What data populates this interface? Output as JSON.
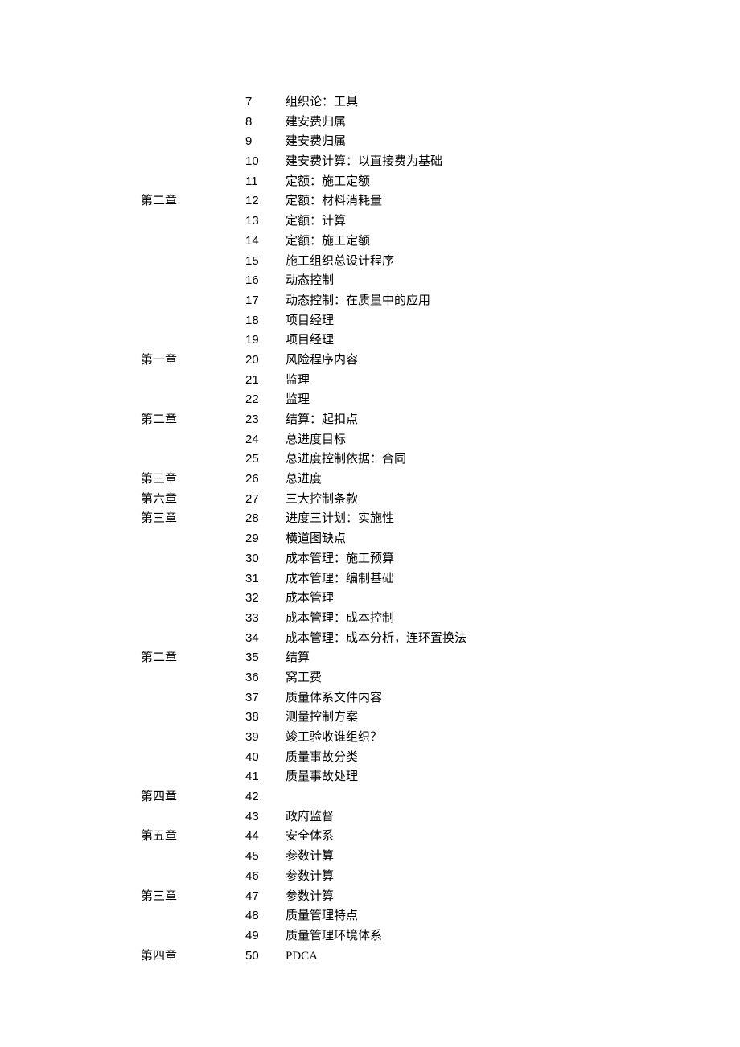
{
  "rows": [
    {
      "chapter": "",
      "num": "7",
      "topic": "组织论：工具"
    },
    {
      "chapter": "",
      "num": "8",
      "topic": "建安费归属"
    },
    {
      "chapter": "",
      "num": "9",
      "topic": "建安费归属"
    },
    {
      "chapter": "",
      "num": "10",
      "topic": "建安费计算：以直接费为基础"
    },
    {
      "chapter": "",
      "num": "11",
      "topic": "定额：施工定额"
    },
    {
      "chapter": "第二章",
      "num": "12",
      "topic": "定额：材料消耗量"
    },
    {
      "chapter": "",
      "num": "13",
      "topic": "定额：计算"
    },
    {
      "chapter": "",
      "num": "14",
      "topic": "定额：施工定额"
    },
    {
      "chapter": "",
      "num": "15",
      "topic": "施工组织总设计程序"
    },
    {
      "chapter": "",
      "num": "16",
      "topic": "动态控制"
    },
    {
      "chapter": "",
      "num": "17",
      "topic": "动态控制：在质量中的应用"
    },
    {
      "chapter": "",
      "num": "18",
      "topic": "项目经理"
    },
    {
      "chapter": "",
      "num": "19",
      "topic": "项目经理"
    },
    {
      "chapter": "第一章",
      "num": "20",
      "topic": "风险程序内容"
    },
    {
      "chapter": "",
      "num": "21",
      "topic": "监理"
    },
    {
      "chapter": "",
      "num": "22",
      "topic": "监理"
    },
    {
      "chapter": "第二章",
      "num": "23",
      "topic": "结算：起扣点"
    },
    {
      "chapter": "",
      "num": "24",
      "topic": "总进度目标"
    },
    {
      "chapter": "",
      "num": "25",
      "topic": "总进度控制依据：合同"
    },
    {
      "chapter": "第三章",
      "num": "26",
      "topic": "总进度"
    },
    {
      "chapter": "第六章",
      "num": "27",
      "topic": "三大控制条款"
    },
    {
      "chapter": "第三章",
      "num": "28",
      "topic": "进度三计划：实施性"
    },
    {
      "chapter": "",
      "num": "29",
      "topic": "横道图缺点"
    },
    {
      "chapter": "",
      "num": "30",
      "topic": "成本管理：施工预算"
    },
    {
      "chapter": "",
      "num": "31",
      "topic": "成本管理：编制基础"
    },
    {
      "chapter": "",
      "num": "32",
      "topic": "成本管理"
    },
    {
      "chapter": "",
      "num": "33",
      "topic": "成本管理：成本控制"
    },
    {
      "chapter": "",
      "num": "34",
      "topic": "成本管理：成本分析，连环置换法"
    },
    {
      "chapter": "第二章",
      "num": "35",
      "topic": "结算"
    },
    {
      "chapter": "",
      "num": "36",
      "topic": "窝工费"
    },
    {
      "chapter": "",
      "num": "37",
      "topic": "质量体系文件内容"
    },
    {
      "chapter": "",
      "num": "38",
      "topic": "测量控制方案"
    },
    {
      "chapter": "",
      "num": "39",
      "topic": "竣工验收谁组织？"
    },
    {
      "chapter": "",
      "num": "40",
      "topic": "质量事故分类"
    },
    {
      "chapter": "",
      "num": "41",
      "topic": "质量事故处理"
    },
    {
      "chapter": "第四章",
      "num": "42",
      "topic": ""
    },
    {
      "chapter": "",
      "num": "43",
      "topic": "政府监督"
    },
    {
      "chapter": "第五章",
      "num": "44",
      "topic": "安全体系"
    },
    {
      "chapter": "",
      "num": "45",
      "topic": "参数计算"
    },
    {
      "chapter": "",
      "num": "46",
      "topic": "参数计算"
    },
    {
      "chapter": "第三章",
      "num": "47",
      "topic": "参数计算"
    },
    {
      "chapter": "",
      "num": "48",
      "topic": "质量管理特点"
    },
    {
      "chapter": "",
      "num": "49",
      "topic": "质量管理环境体系"
    },
    {
      "chapter": "第四章",
      "num": "50",
      "topic": "PDCA"
    }
  ]
}
